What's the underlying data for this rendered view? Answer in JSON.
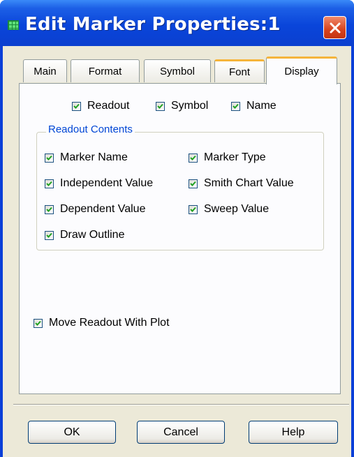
{
  "window": {
    "title": "Edit Marker Properties:1"
  },
  "tabs": [
    {
      "label": "Main"
    },
    {
      "label": "Format"
    },
    {
      "label": "Symbol"
    },
    {
      "label": "Font"
    },
    {
      "label": "Display",
      "active": true
    }
  ],
  "display": {
    "top_options": [
      {
        "label": "Readout",
        "checked": true
      },
      {
        "label": "Symbol",
        "checked": true
      },
      {
        "label": "Name",
        "checked": true
      }
    ],
    "readout_contents": {
      "legend": "Readout Contents",
      "items": [
        {
          "label": "Marker Name",
          "checked": true
        },
        {
          "label": "Marker Type",
          "checked": true
        },
        {
          "label": "Independent Value",
          "checked": true
        },
        {
          "label": "Smith Chart Value",
          "checked": true
        },
        {
          "label": "Dependent Value",
          "checked": true
        },
        {
          "label": "Sweep Value",
          "checked": true
        },
        {
          "label": "Draw Outline",
          "checked": true
        }
      ]
    },
    "move_readout": {
      "label": "Move Readout With Plot",
      "checked": true
    }
  },
  "buttons": {
    "ok": "OK",
    "cancel": "Cancel",
    "help": "Help"
  },
  "colors": {
    "title_bar": "#0a45da",
    "check": "#21a121",
    "legend_text": "#0046d5",
    "active_tab_accent": "#f5b43a"
  },
  "icons": {
    "app": "grid-icon",
    "close": "close-icon",
    "check": "checkmark-icon"
  }
}
